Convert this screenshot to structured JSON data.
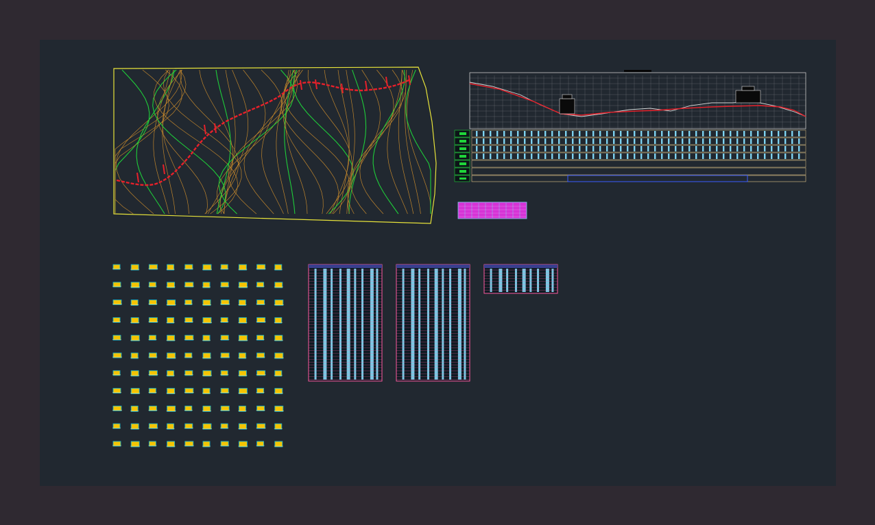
{
  "window": {
    "title": ""
  },
  "colors": {
    "outer_frame": "#2f2931",
    "model_space": "#212830",
    "plan_border": "#e8e43a",
    "contour_minor": "#c88a2c",
    "contour_major": "#1fd63a",
    "road_axis": "#e8202a",
    "profile_grid": "#c9c9c9",
    "profile_band": "#7fd3f0",
    "band_label": "#1fd63a",
    "table_border": "#ff5aa0",
    "table_fill": "#7fd3f0",
    "section_fill": "#f4c400",
    "section_outline": "#19b0c8",
    "legend_fill": "#d633d6"
  },
  "drawing": {
    "sheets": [
      {
        "kind": "plan",
        "description_icon": "topographic-plan-icon"
      },
      {
        "kind": "longitudinal-profile",
        "description_icon": "profile-icon"
      },
      {
        "kind": "legend-table",
        "description_icon": "legend-icon"
      },
      {
        "kind": "cross-sections",
        "rows": 11,
        "columns": 10
      },
      {
        "kind": "earthwork-table",
        "count": 3
      }
    ]
  }
}
